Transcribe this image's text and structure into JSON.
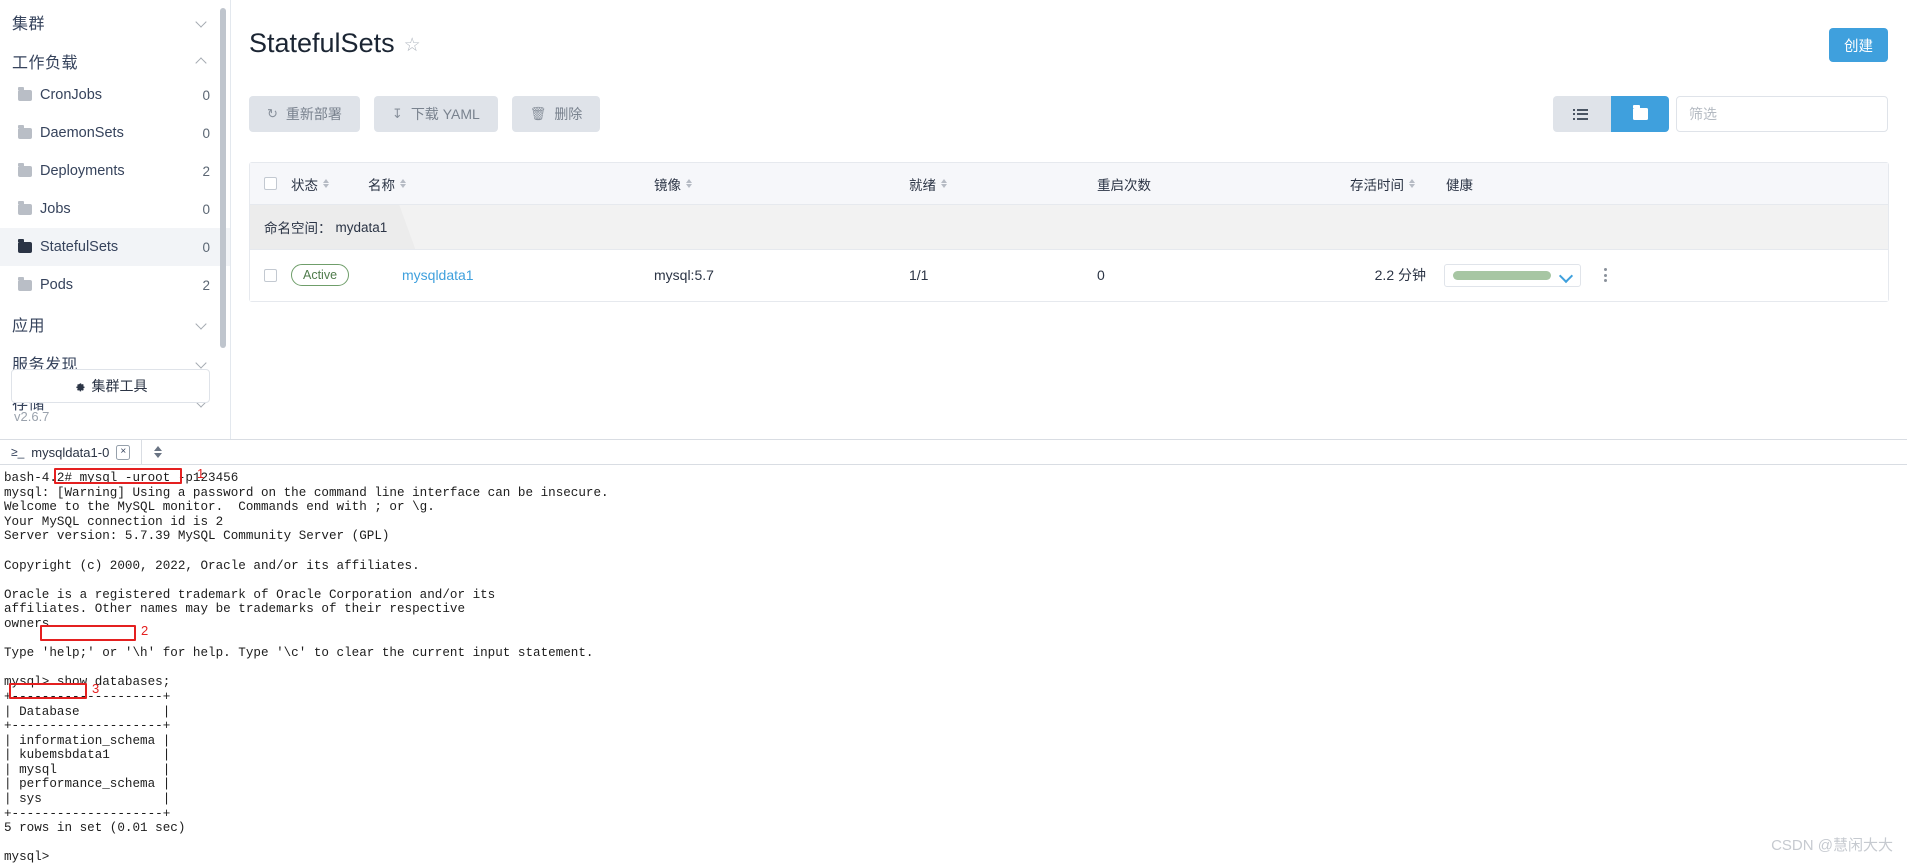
{
  "sidebar": {
    "scrollbar": true,
    "groups": [
      {
        "label": "集群",
        "expanded": false
      },
      {
        "label": "工作负载",
        "expanded": true
      }
    ],
    "items": [
      {
        "label": "CronJobs",
        "count": "0",
        "active": false
      },
      {
        "label": "DaemonSets",
        "count": "0",
        "active": false
      },
      {
        "label": "Deployments",
        "count": "2",
        "active": false
      },
      {
        "label": "Jobs",
        "count": "0",
        "active": false
      },
      {
        "label": "StatefulSets",
        "count": "0",
        "active": true
      },
      {
        "label": "Pods",
        "count": "2",
        "active": false
      }
    ],
    "groups_bottom": [
      {
        "label": "应用",
        "expanded": false
      },
      {
        "label": "服务发现",
        "expanded": false
      },
      {
        "label": "存储",
        "expanded": false
      }
    ],
    "cluster_tools_label": "集群工具",
    "version": "v2.6.7"
  },
  "header": {
    "title": "StatefulSets",
    "star_icon": "star-outline-icon",
    "create_label": "创建"
  },
  "toolbar": {
    "buttons": [
      {
        "icon": "refresh-icon",
        "glyph": "↻",
        "label": "重新部署"
      },
      {
        "icon": "download-icon",
        "glyph": "⤓",
        "label": "下载 YAML"
      },
      {
        "icon": "trash-icon",
        "glyph": "Ὕ1",
        "label": "删除"
      }
    ],
    "view_list_icon": "list-view-icon",
    "view_card_icon": "folder-view-icon",
    "filter_placeholder": "筛选"
  },
  "table": {
    "columns": [
      {
        "label": "状态",
        "sortable": true
      },
      {
        "label": "名称",
        "sortable": true
      },
      {
        "label": "镜像",
        "sortable": true
      },
      {
        "label": "就绪",
        "sortable": true
      },
      {
        "label": "重启次数",
        "sortable": false
      },
      {
        "label": "存活时间",
        "sortable": true
      },
      {
        "label": "健康",
        "sortable": false
      }
    ],
    "namespace_label": "命名空间：",
    "namespace_value": "mydata1",
    "rows": [
      {
        "status": "Active",
        "name": "mysqldata1",
        "image": "mysql:5.7",
        "ready": "1/1",
        "restarts": "0",
        "age": "2.2 分钟",
        "health_pct": 100
      }
    ]
  },
  "terminal": {
    "tab_label": "mysqldata1-0",
    "tab_prompt_glyph": "≥_",
    "tab_close_glyph": "×",
    "lines": [
      "bash-4.2# mysql -uroot -p123456",
      "mysql: [Warning] Using a password on the command line interface can be insecure.",
      "Welcome to the MySQL monitor.  Commands end with ; or \\g.",
      "Your MySQL connection id is 2",
      "Server version: 5.7.39 MySQL Community Server (GPL)",
      "",
      "Copyright (c) 2000, 2022, Oracle and/or its affiliates.",
      "",
      "Oracle is a registered trademark of Oracle Corporation and/or its",
      "affiliates. Other names may be trademarks of their respective",
      "owners.",
      "",
      "Type 'help;' or '\\h' for help. Type '\\c' to clear the current input statement.",
      "",
      "mysql> show databases;",
      "+--------------------+",
      "| Database           |",
      "+--------------------+",
      "| information_schema |",
      "| kubemsbdata1       |",
      "| mysql              |",
      "| performance_schema |",
      "| sys                |",
      "+--------------------+",
      "5 rows in set (0.01 sec)",
      "",
      "mysql>"
    ],
    "annotations": [
      {
        "num": "1",
        "target": "mysql -uroot -p123456"
      },
      {
        "num": "2",
        "target": "show databases;"
      },
      {
        "num": "3",
        "target": "kubemsbdata1"
      }
    ]
  },
  "watermark": "CSDN @慧闲大大",
  "colors": {
    "accent": "#3fa0dd",
    "button_gray": "#dfe3e9",
    "annotation_red": "#e42020",
    "health_green": "#a7c6a3",
    "badge_green": "#6f9e6a"
  }
}
